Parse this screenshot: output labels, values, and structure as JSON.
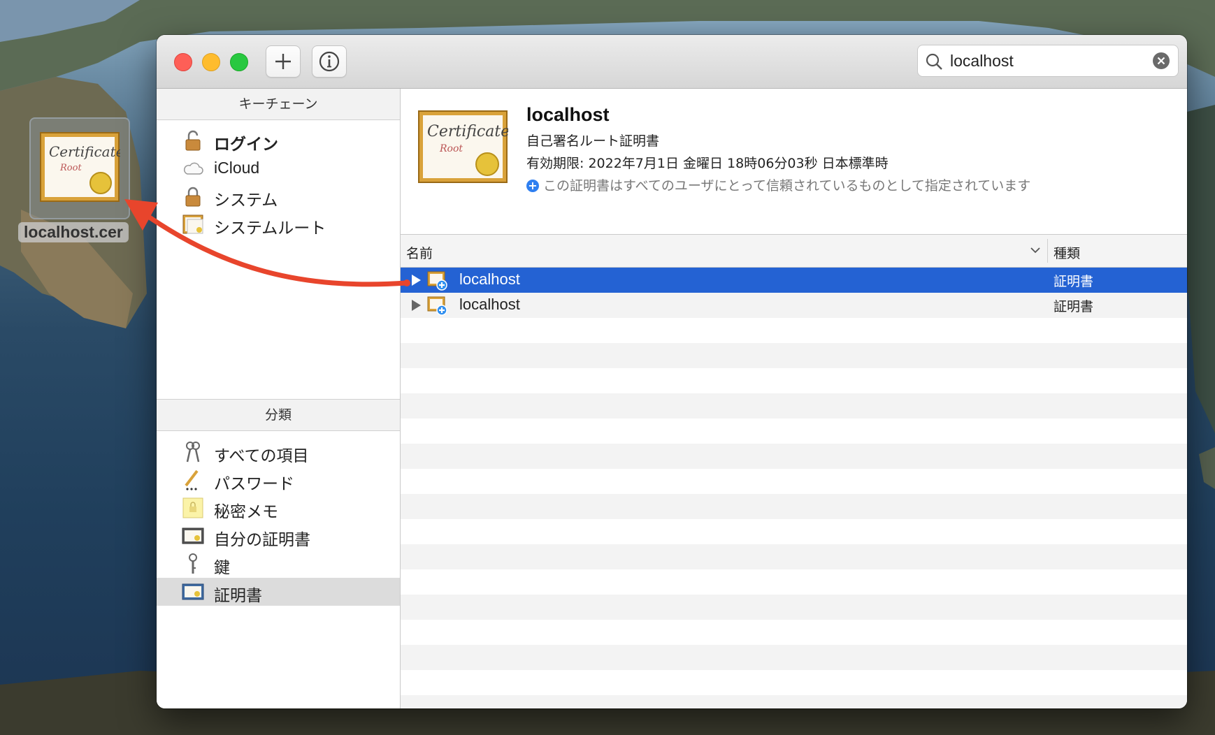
{
  "desktop": {
    "file_label": "localhost.cer",
    "icon": "certificate-icon"
  },
  "window": {
    "toolbar": {
      "add_icon": "plus-icon",
      "info_icon": "info-icon"
    },
    "search": {
      "value": "localhost",
      "icon": "search-icon",
      "clear_icon": "clear-icon"
    },
    "sidebar": {
      "keychains_header": "キーチェーン",
      "keychains": [
        {
          "label": "ログイン",
          "icon": "unlocked-padlock-icon"
        },
        {
          "label": "iCloud",
          "icon": "cloud-icon"
        },
        {
          "label": "システム",
          "icon": "locked-padlock-icon"
        },
        {
          "label": "システムルート",
          "icon": "certificate-cabinet-icon"
        }
      ],
      "category_header": "分類",
      "categories": [
        {
          "label": "すべての項目",
          "icon": "keys-icon"
        },
        {
          "label": "パスワード",
          "icon": "pencil-icon"
        },
        {
          "label": "秘密メモ",
          "icon": "note-icon"
        },
        {
          "label": "自分の証明書",
          "icon": "my-certificate-icon"
        },
        {
          "label": "鍵",
          "icon": "key-icon"
        },
        {
          "label": "証明書",
          "icon": "certificate-icon"
        }
      ]
    },
    "detail": {
      "title": "localhost",
      "subtitle": "自己署名ルート証明書",
      "expiry": "有効期限: 2022年7月1日 金曜日 18時06分03秒 日本標準時",
      "trust": "この証明書はすべてのユーザにとって信頼されているものとして指定されています"
    },
    "table": {
      "col_name": "名前",
      "col_kind": "種類",
      "rows": [
        {
          "name": "localhost",
          "kind": "証明書",
          "selected": true
        },
        {
          "name": "localhost",
          "kind": "証明書",
          "selected": false
        }
      ]
    }
  },
  "colors": {
    "selection": "#2462d3",
    "arrow": "#e8452c"
  }
}
